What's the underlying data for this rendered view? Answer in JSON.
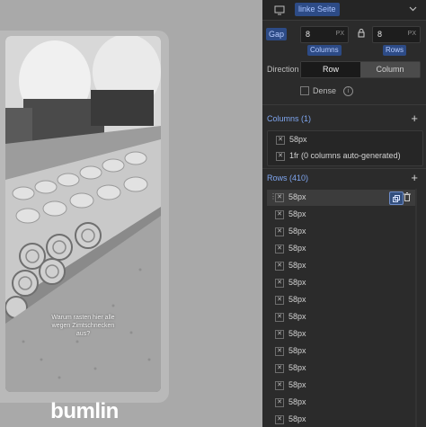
{
  "preview": {
    "caption_lines": [
      "Warum rasten hier alle",
      "wegen Zimtschnecken",
      "aus?"
    ],
    "brand": "bumlin"
  },
  "topbar": {
    "link_label": "linke Seite"
  },
  "gap": {
    "label": "Gap",
    "columns_value": "8",
    "columns_unit": "PX",
    "rows_value": "8",
    "rows_unit": "PX",
    "columns_label": "Columns",
    "rows_label": "Rows"
  },
  "direction": {
    "label": "Direction",
    "options": [
      "Row",
      "Column"
    ],
    "selected": "Row"
  },
  "dense": {
    "label": "Dense",
    "checked": false
  },
  "columns_section": {
    "title": "Columns (1)",
    "items": [
      "58px",
      "1fr (0 columns auto-generated)"
    ]
  },
  "rows_section": {
    "title": "Rows (410)",
    "items": [
      "58px",
      "58px",
      "58px",
      "58px",
      "58px",
      "58px",
      "58px",
      "58px",
      "58px",
      "58px",
      "58px",
      "58px",
      "58px",
      "58px"
    ]
  },
  "colors": {
    "accent": "#2d4b86",
    "accent_text": "#7fa6f0",
    "panel_bg": "#2b2b2b"
  },
  "icons": [
    "desktop-icon",
    "chevron-down-icon",
    "lock-icon",
    "info-icon",
    "plus-icon",
    "drag-handle-icon",
    "grid-track-icon",
    "duplicate-icon",
    "trash-icon"
  ]
}
